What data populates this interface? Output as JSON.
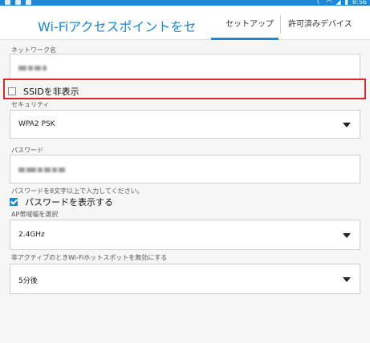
{
  "status_bar": {
    "time": "8:56",
    "icons": [
      "moon-icon",
      "wifi-icon",
      "signal-icon",
      "battery-icon"
    ]
  },
  "header": {
    "title": "Wi-Fiアクセスポイントをセット...",
    "tabs": [
      {
        "label": "セットアップ",
        "active": true
      },
      {
        "label": "許可済みデバイス",
        "active": false
      }
    ]
  },
  "form": {
    "network_name_label": "ネットワーク名",
    "hide_ssid_label": "SSIDを非表示",
    "hide_ssid_checked": false,
    "security_label": "セキュリティ",
    "security_value": "WPA2 PSK",
    "password_label": "パスワード",
    "password_hint": "パスワードを8文字以上で入力してください。",
    "show_password_label": "パスワードを表示する",
    "show_password_checked": true,
    "ap_band_label": "AP帯域幅を選択",
    "ap_band_value": "2.4GHz",
    "inactive_label": "非アクティブのときWi-Fiホットスポットを無効にする",
    "inactive_value": "5分後"
  },
  "colors": {
    "accent": "#1a88d8",
    "highlight": "#d42a2a"
  }
}
